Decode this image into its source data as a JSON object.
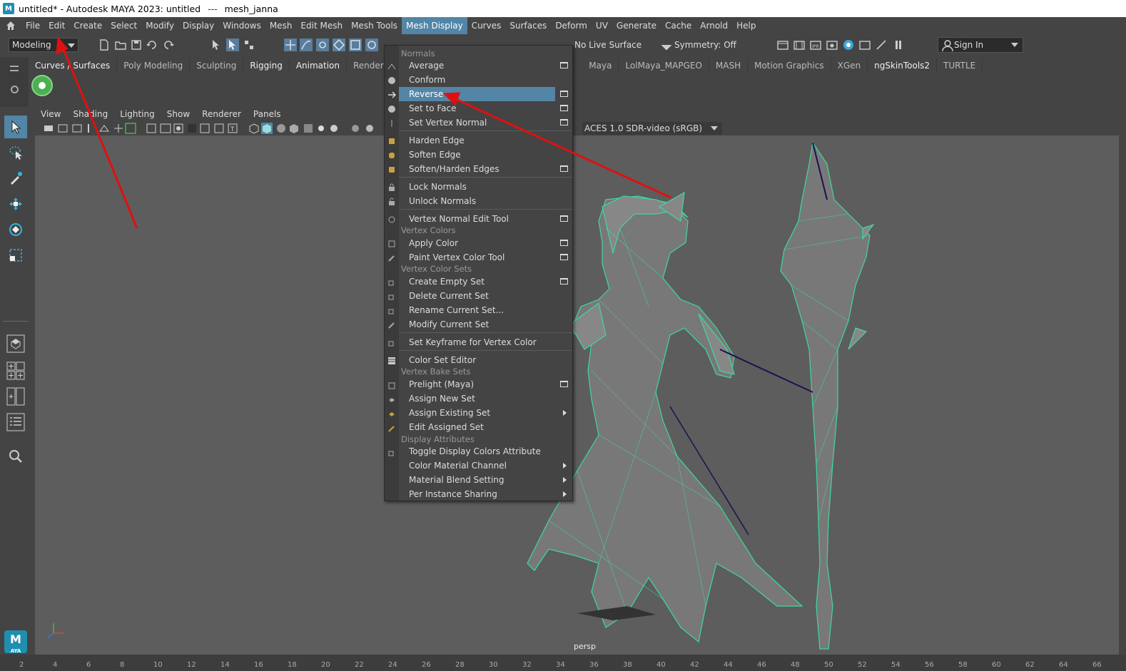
{
  "titlebar": {
    "title": "untitled* - Autodesk MAYA 2023: untitled",
    "sep": "---",
    "file": "mesh_janna"
  },
  "menubar": {
    "items": [
      "File",
      "Edit",
      "Create",
      "Select",
      "Modify",
      "Display",
      "Windows",
      "Mesh",
      "Edit Mesh",
      "Mesh Tools",
      "Mesh Display",
      "Curves",
      "Surfaces",
      "Deform",
      "UV",
      "Generate",
      "Cache",
      "Arnold",
      "Help"
    ],
    "active_index": 10
  },
  "toolbar": {
    "mode": "Modeling",
    "live_surface": "No Live Surface",
    "symmetry": "Symmetry: Off",
    "sign_in": "Sign In"
  },
  "shelf_tabs": [
    "Curves / Surfaces",
    "Poly Modeling",
    "Sculpting",
    "Rigging",
    "Animation",
    "Rendering",
    "Maya",
    "LolMaya_MAPGEO",
    "MASH",
    "Motion Graphics",
    "XGen",
    "ngSkinTools2",
    "TURTLE"
  ],
  "panel_menu": [
    "View",
    "Shading",
    "Lighting",
    "Show",
    "Renderer",
    "Panels"
  ],
  "color_space": "ACES 1.0 SDR-video (sRGB)",
  "viewport": {
    "camera": "persp"
  },
  "timeline_ticks": [
    "2",
    "4",
    "6",
    "8",
    "10",
    "12",
    "14",
    "16",
    "18",
    "20",
    "22",
    "24",
    "26",
    "28",
    "30",
    "32",
    "34",
    "36",
    "38",
    "40",
    "42",
    "44",
    "46",
    "48",
    "50",
    "52",
    "54",
    "56",
    "58",
    "60",
    "62",
    "64",
    "66"
  ],
  "menu": {
    "headers": {
      "normals": "Normals",
      "vertex_colors": "Vertex Colors",
      "vertex_color_sets": "Vertex Color Sets",
      "vertex_bake_sets": "Vertex Bake Sets",
      "display_attributes": "Display Attributes"
    },
    "items": {
      "average": "Average",
      "conform": "Conform",
      "reverse": "Reverse",
      "set_to_face": "Set to Face",
      "set_vertex_normal": "Set Vertex Normal",
      "harden_edge": "Harden Edge",
      "soften_edge": "Soften Edge",
      "soften_harden_edges": "Soften/Harden Edges",
      "lock_normals": "Lock Normals",
      "unlock_normals": "Unlock Normals",
      "vertex_normal_edit_tool": "Vertex Normal Edit Tool",
      "apply_color": "Apply Color",
      "paint_vertex_color_tool": "Paint Vertex Color Tool",
      "create_empty_set": "Create Empty Set",
      "delete_current_set": "Delete Current Set",
      "rename_current_set": "Rename Current Set...",
      "modify_current_set": "Modify Current Set",
      "set_keyframe_vertex_color": "Set Keyframe for Vertex Color",
      "color_set_editor": "Color Set Editor",
      "prelight": "Prelight (Maya)",
      "assign_new_set": "Assign New Set",
      "assign_existing_set": "Assign Existing Set",
      "edit_assigned_set": "Edit Assigned Set",
      "toggle_display_colors": "Toggle Display Colors Attribute",
      "color_material_channel": "Color Material Channel",
      "material_blend_setting": "Material Blend Setting",
      "per_instance_sharing": "Per Instance Sharing"
    }
  },
  "colors": {
    "accent": "#5285a6",
    "wireframe": "#3de0a0",
    "annotation_arrow": "#e01010"
  }
}
